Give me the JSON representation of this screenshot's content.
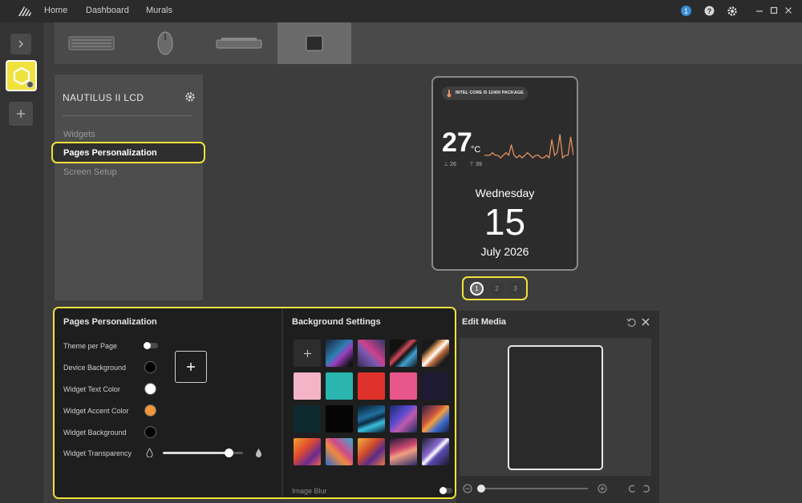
{
  "nav": {
    "home": "Home",
    "dashboard": "Dashboard",
    "murals": "Murals",
    "notification_count": "1"
  },
  "device": {
    "title": "NAUTILUS II LCD",
    "menu": [
      "Widgets",
      "Pages Personalization",
      "Screen Setup"
    ]
  },
  "lcd": {
    "sensor_label": "INTEL CORE I5 12400 PACKAGE",
    "temperature": "27",
    "unit": "°C",
    "min_value": "26",
    "max_value": "39",
    "day": "Wednesday",
    "date": "15",
    "month_year": "July 2026",
    "graph_line_color": "#e39060",
    "temp_history": [
      30,
      30,
      30,
      31,
      30,
      30,
      29,
      30,
      31,
      30,
      34,
      30,
      29,
      30,
      29,
      30,
      31,
      30,
      29,
      30,
      30,
      29,
      29,
      30,
      29,
      36,
      30,
      31,
      38,
      29,
      30,
      30,
      37,
      30
    ]
  },
  "pager": {
    "pages": [
      "1",
      "2",
      "3"
    ],
    "active": 0
  },
  "personalization": {
    "title": "Pages Personalization",
    "rows": {
      "theme_per_page": "Theme per Page",
      "device_background": "Device Background",
      "widget_text_color": "Widget Text Color",
      "widget_accent_color": "Widget Accent Color",
      "widget_background": "Widget Background",
      "widget_transparency": "Widget Transparency"
    },
    "colors": {
      "device_background": "#000000",
      "widget_text": "#ffffff",
      "widget_accent": "#f0963c",
      "widget_background": "#000000"
    },
    "transparency_level": 0.82
  },
  "background_settings": {
    "title": "Background Settings",
    "solid_colors": [
      "#f4b4c8",
      "#2ab5ae",
      "#e0312b",
      "#e8568a",
      "#1f1a33",
      "#0e2a2e",
      "#050505"
    ],
    "image_blur_label": "Image Blur"
  },
  "edit_media": {
    "title": "Edit Media",
    "zoom_level": 0.0
  },
  "colors": {
    "accent_highlight": "#f0e23c",
    "selected_device": "#f0e23c"
  }
}
